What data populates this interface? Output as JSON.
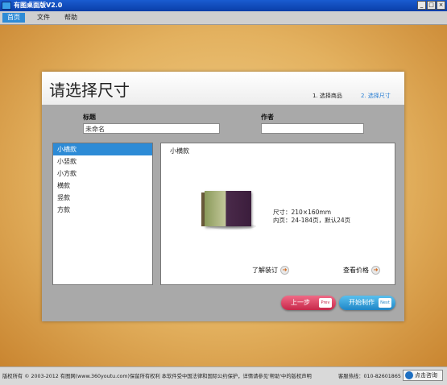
{
  "window": {
    "title": "有图桌面版V2.0",
    "min": "_",
    "max": "□",
    "close": "×"
  },
  "menu": [
    "首页",
    "文件",
    "帮助"
  ],
  "page": {
    "heading": "请选择尺寸",
    "steps": [
      "1. 选择商品",
      "2. 选择尺寸"
    ],
    "title_label": "标题",
    "title_value": "未命名",
    "author_label": "作者",
    "author_value": ""
  },
  "sizes": [
    "小横款",
    "小竖款",
    "小方款",
    "横款",
    "竖款",
    "方款"
  ],
  "preview": {
    "name": "小横款",
    "size_text": "尺寸：210×160mm",
    "pages_text": "内页：24-184页，默认24页",
    "learn_binding": "了解装订",
    "view_price": "查看价格"
  },
  "buttons": {
    "prev": "上一步",
    "prev_tag": "Prev",
    "start": "开始制作",
    "start_tag": "Next"
  },
  "status": {
    "copyright": "版权所有 © 2003-2012 有图网(www.360youtu.com)保留所有权利 本软件受中国法律和国际公约保护，详情请参见'帮助'中的版权声明",
    "hotline": "客服热线：010-82601865",
    "consult": "点击咨询"
  },
  "colors": {
    "accent": "#2d8bd6",
    "prev_button": "#d9345a",
    "start_button": "#2c9ad8",
    "background": "#e3b15f"
  }
}
